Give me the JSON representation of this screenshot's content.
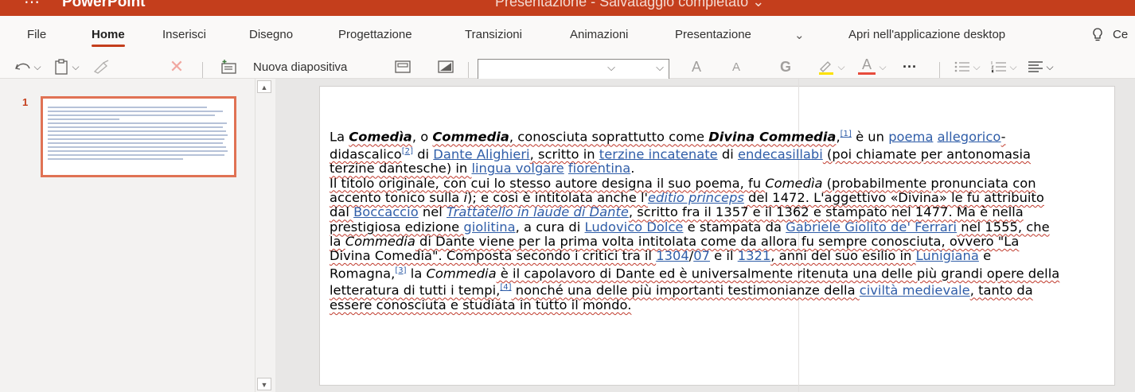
{
  "titlebar": {
    "app_name": "PowerPoint",
    "doc_title": "Presentazione - Salvataggio completato ⌄",
    "color": "#c43e1c"
  },
  "tabs": [
    "File",
    "Home",
    "Inserisci",
    "Disegno",
    "Progettazione",
    "Transizioni",
    "Animazioni",
    "Presentazione"
  ],
  "ribbon": {
    "more_tabs_glyph": "⌄",
    "open_desktop": "Apri nell'applicazione desktop",
    "tell_me_partial": "Ce",
    "new_slide": "Nuova diapositiva",
    "font_grow": "A",
    "font_shrink": "A",
    "bold_glyph": "G",
    "font_color_glyph": "A",
    "more_glyph": "···"
  },
  "thumbnail": {
    "number": "1"
  },
  "slide": {
    "p1": {
      "t1": "La ",
      "t2": "Comedìa",
      "t3": ", o ",
      "t4": "Commedia",
      "t5": ", conosciuta soprattutto come ",
      "t6": "Divina Commedia",
      "t7": ",",
      "ref1": "[1]",
      "t8": " è un ",
      "l1": "poema",
      "t9": " ",
      "l2": "allegorico",
      "t10": "-didascalico",
      "ref2": "[2]",
      "t11": " di ",
      "l3": "Dante Alighieri",
      "t12": ", scritto in ",
      "l4": "terzine incatenate",
      "t13": " di ",
      "l5": "endecasillabi",
      "t14": " (poi chiamate per antonomasia terzine dantesche) in ",
      "l6": "lingua volgare",
      "t15": " ",
      "l7": "fiorentina",
      "t16": "."
    },
    "p2": {
      "t1": "Il titolo originale, con cui lo stesso autore designa il suo poema, fu ",
      "t2": "Comedìa",
      "t3": " (probabilmente pronunciata con accento tonico sulla ",
      "t4": "i",
      "t5": "); e così è intitolata anche l'",
      "l1": "editio princeps",
      "t6": " del 1472. L'aggettivo «Divina» le fu attribuito dal ",
      "l2": "Boccaccio",
      "t7": " nel ",
      "l3": "Trattatello in laude di Dante",
      "t8": ", scritto fra il 1357 e il 1362 e stampato nel 1477. Ma è nella prestigiosa edizione ",
      "l4": "giolitina",
      "t9": ", a cura di ",
      "l5": "Ludovico Dolce",
      "t10": " e stampata da ",
      "l6": "Gabriele Giolito de' Ferrari",
      "t11": " nel 1555, che la ",
      "t12": "Commedia",
      "t13": " di Dante viene per la prima volta intitolata come da allora fu sempre conosciuta, ovvero \"La Divina Comedia\". Composta secondo i critici tra il ",
      "l7": "1304",
      "t14": "/",
      "l8": "07",
      "t15": " e il ",
      "l9": "1321",
      "t16": ", anni del suo esilio in ",
      "l10": "Lunigiana",
      "t17": " e Romagna,",
      "ref3": "[3]",
      "t18": " la ",
      "t19": "Commedia",
      "t20": " è il capolavoro di Dante ed è universalmente ritenuta una delle più grandi opere della letteratura di tutti i tempi,",
      "ref4": "[4]",
      "t21": " nonché una delle più importanti testimonianze della ",
      "l11": "civiltà medievale",
      "t22": ", tanto da essere conosciuta e studiata in tutto il mondo."
    }
  }
}
